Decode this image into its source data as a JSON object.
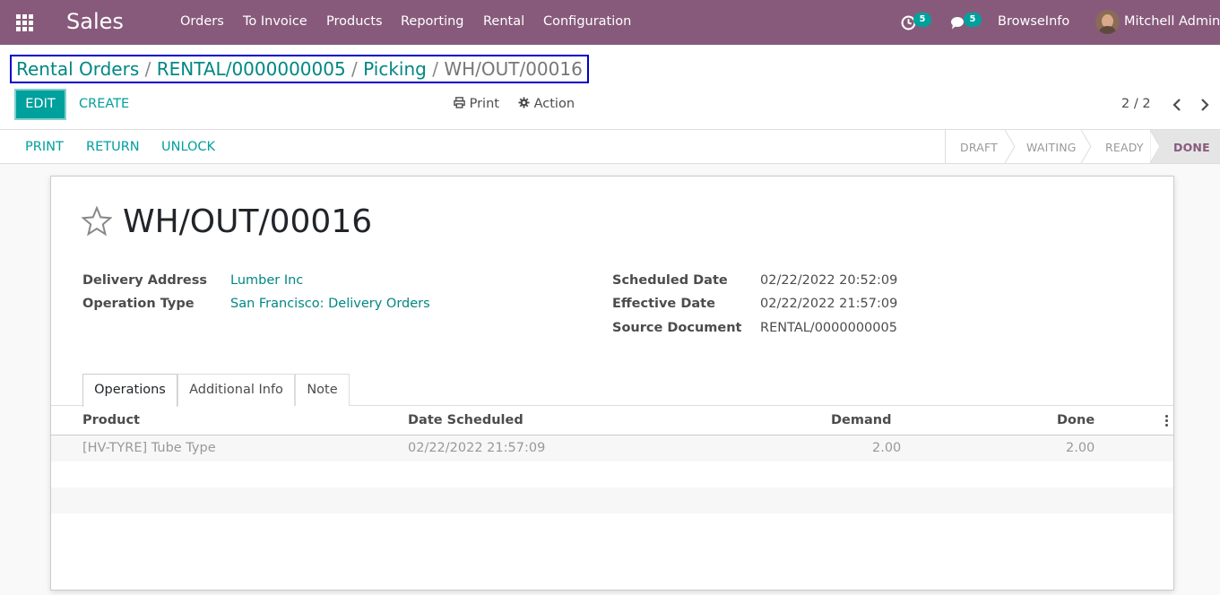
{
  "navbar": {
    "app_name": "Sales",
    "menu": [
      "Orders",
      "To Invoice",
      "Products",
      "Reporting",
      "Rental",
      "Configuration"
    ],
    "activity_count": "5",
    "messages_count": "5",
    "company": "BrowseInfo",
    "user": "Mitchell Admin",
    "bg_color": "#875a7b"
  },
  "breadcrumb": {
    "items": [
      "Rental Orders",
      "RENTAL/0000000005",
      "Picking"
    ],
    "separator": "/",
    "current": "WH/OUT/00016"
  },
  "control": {
    "edit_label": "EDIT",
    "create_label": "CREATE",
    "print_label": "Print",
    "action_label": "Action",
    "pager": "2 / 2"
  },
  "statusbar": {
    "buttons": [
      "PRINT",
      "RETURN",
      "UNLOCK"
    ],
    "stages": [
      "DRAFT",
      "WAITING",
      "READY",
      "DONE"
    ],
    "current_stage": "DONE"
  },
  "record": {
    "title": "WH/OUT/00016",
    "left_fields": [
      {
        "label": "Delivery Address",
        "value": "Lumber Inc"
      },
      {
        "label": "Operation Type",
        "value": "San Francisco: Delivery Orders"
      }
    ],
    "right_fields": [
      {
        "label": "Scheduled Date",
        "value": "02/22/2022 20:52:09"
      },
      {
        "label": "Effective Date",
        "value": "02/22/2022 21:57:09"
      },
      {
        "label": "Source Document",
        "value": "RENTAL/0000000005"
      }
    ]
  },
  "tabs": [
    "Operations",
    "Additional Info",
    "Note"
  ],
  "active_tab": "Operations",
  "table": {
    "headers": [
      "Product",
      "Date Scheduled",
      "Demand",
      "Done"
    ],
    "rows": [
      {
        "product": "[HV-TYRE] Tube Type",
        "date": "02/22/2022 21:57:09",
        "demand": "2.00",
        "done": "2.00"
      }
    ]
  },
  "accent_color": "#00a09d",
  "link_color": "#008784"
}
